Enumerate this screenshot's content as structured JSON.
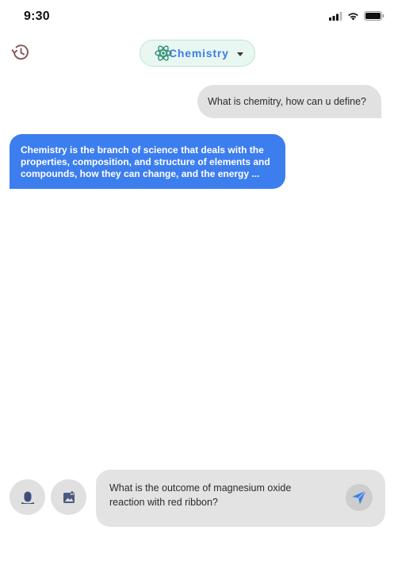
{
  "status_bar": {
    "time": "9:30",
    "icons": [
      "signal-icon",
      "wifi-icon",
      "battery-icon"
    ]
  },
  "header": {
    "history_icon": "history-icon",
    "subject": {
      "icon": "atom-icon",
      "label": "Chemistry",
      "dropdown_icon": "caret-down-icon"
    }
  },
  "chat": {
    "messages": [
      {
        "role": "user",
        "text": "What is chemitry, how can u define?"
      },
      {
        "role": "assistant",
        "text": "Chemistry is the branch of science that deals with the properties, composition, and structure of elements and compounds, how they can change, and the energy ..."
      }
    ]
  },
  "composer": {
    "mic_icon": "microphone-icon",
    "attach_icon": "image-upload-icon",
    "input_value": "What is the outcome of magnesium oxide reaction with red ribbon?",
    "send_icon": "send-icon"
  },
  "colors": {
    "accent_blue": "#3d7eee",
    "user_bubble": "#e1e1e1",
    "pill_background": "#e9f7f1",
    "pill_border": "#bfe3d4",
    "atom_icon": "#2f8f74",
    "history_icon": "#8a5a5a"
  }
}
